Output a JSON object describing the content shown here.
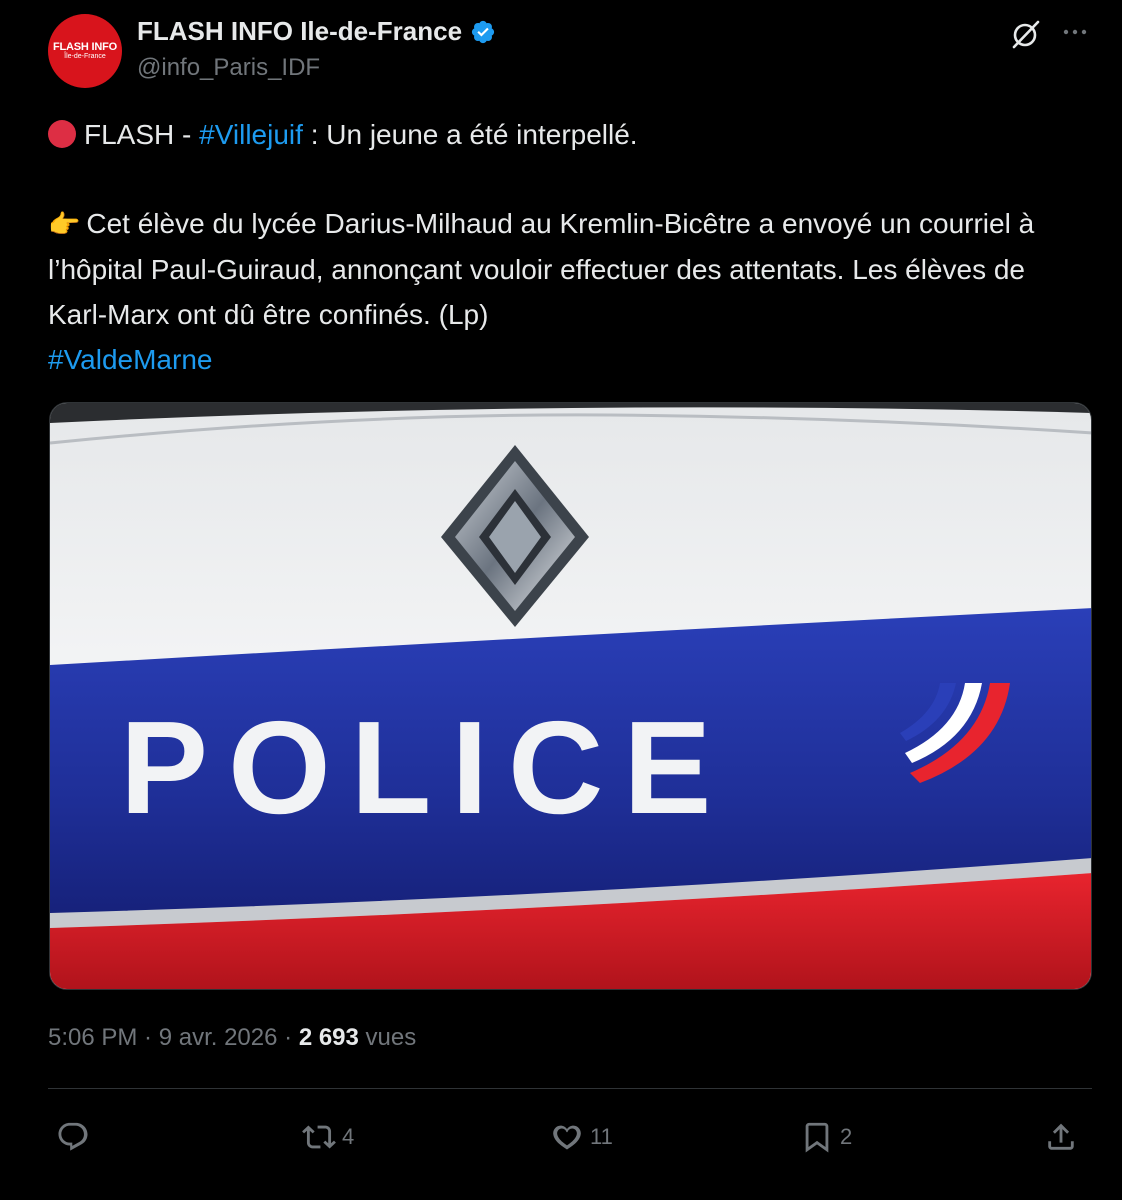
{
  "author": {
    "avatar_line1": "FLASH INFO",
    "avatar_line2": "Île-de-France",
    "display_name": "FLASH INFO Ile-de-France",
    "handle": "@info_Paris_IDF",
    "verified_icon": "verified-badge-icon"
  },
  "post": {
    "line1_prefix": "FLASH - ",
    "line1_hashtag": "#Villejuif",
    "line1_suffix": " : Un jeune a été interpellé.",
    "para2": "Cet élève du lycée Darius-Milhaud au Kremlin-Bicêtre a envoyé un courriel à l’hôpital Paul-Guiraud, annonçant vouloir effectuer des attentats. Les élèves de Karl-Marx ont dû être confinés. (Lp)",
    "hashtag2": "#ValdeMarne",
    "image_text": "POLICE"
  },
  "meta": {
    "time": "5:06 PM",
    "sep1": " · ",
    "date": "9 avr. 2026",
    "sep2": " · ",
    "views_count": "2 693",
    "views_label": " vues"
  },
  "actions": {
    "reply_count": "",
    "repost_count": "4",
    "like_count": "11",
    "bookmark_count": "2"
  },
  "colors": {
    "accent": "#1d9bf0",
    "background": "#000000",
    "text": "#e7e9ea",
    "muted": "#71767b",
    "avatar_red": "#d8141c"
  }
}
